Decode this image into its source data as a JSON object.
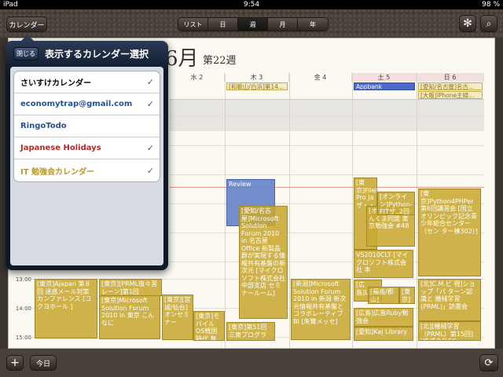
{
  "status": {
    "device": "iPad",
    "time": "9:54",
    "battery": "98 %"
  },
  "toolbar": {
    "calendar_label": "カレンダー",
    "segments": [
      "リスト",
      "日",
      "週",
      "月",
      "年"
    ],
    "active_segment": 2
  },
  "header": {
    "month": "6月",
    "week": "第22週"
  },
  "days": [
    "水 2",
    "木 3",
    "金 4",
    "土 5",
    "日 6"
  ],
  "allday_events": {
    "thu": "[和歌山/白浜]第14...",
    "sat": "Appbank",
    "sun1": "[愛知/名古屋]名古...",
    "sun2": "[大阪]iPhone主婦..."
  },
  "times": [
    "13:00",
    "14:00",
    "15:00"
  ],
  "events": [
    {
      "text": "[東京]Ajapan 第８回 迷惑メール対策カンファレンス [コクヨホール ]"
    },
    {
      "text": "[東京][PRML復々習レーン]第1回"
    },
    {
      "text": "[東京]Microsoft Solution Forum 2010 in 東京 こんなに"
    },
    {
      "text": "[東京][宮城/仙台]オンセミナー"
    },
    {
      "text": "[東京]モバイルOS戦国時代 無料セミナー"
    },
    {
      "text": "Review"
    },
    {
      "text": "[愛知/名古屋]Microsoft Solution Forum 2010 in 名古屋 Office 新製品群が実現する情報共有基盤の新次元 [マイクロソフト株式会社 中部支店 セミナールーム]"
    },
    {
      "text": "[東京]第51回 三東プログラ"
    },
    {
      "text": "[新潟]Microsoft Solution Forum 2010 in 新潟 新次元情報共有基盤とコラボレーティブBI [朱鷺メッセ]"
    },
    {
      "text": "[東京]FileMaker Pro Ja ザ・・"
    },
    {
      "text": "[オンライン]わんくま同盟 東京勉強会 #48"
    },
    {
      "text": "VS2010CLT [マイクロソフト株式会社 本"
    },
    {
      "text": "[オンライン]Python-FITザ..2回目"
    },
    {
      "text": "[東京]Python4PHPer 第6回講習会 [国立オリンピック記念青少年総合センター（セン ター棟302）]"
    },
    {
      "text": "[広島]Linux"
    },
    {
      "text": "[福島/郡山]"
    },
    {
      "text": "[東京]"
    },
    {
      "text": "[広島]広島Ruby勉強会"
    },
    {
      "text": "[愛知]Kaj Library"
    },
    {
      "text": "[北]C.M.ビ 視]ショップ「パ ターン認識と 機械学習 (PRML)」読書会"
    },
    {
      "text": "[北][機械学習（PRML）第15回] [株式会社EC"
    }
  ],
  "popover": {
    "close_label": "閉じる",
    "title": "表示するカレンダー選択",
    "calendars": [
      {
        "name": "さいすけカレンダー",
        "color": "#000000",
        "checked": "✓"
      },
      {
        "name": "economytrap@gmail.com",
        "color": "#2a4f8f",
        "checked": "✓"
      },
      {
        "name": "RingoTodo",
        "color": "#2a4f8f",
        "checked": ""
      },
      {
        "name": "Japanese Holidays",
        "color": "#b22a2a",
        "checked": "✓"
      },
      {
        "name": "IT 勉強会カレンダー",
        "color": "#b8962a",
        "checked": "✓"
      }
    ]
  },
  "bottom": {
    "add_label": "+",
    "today_label": "今日",
    "refresh_icon": "refresh-icon"
  }
}
